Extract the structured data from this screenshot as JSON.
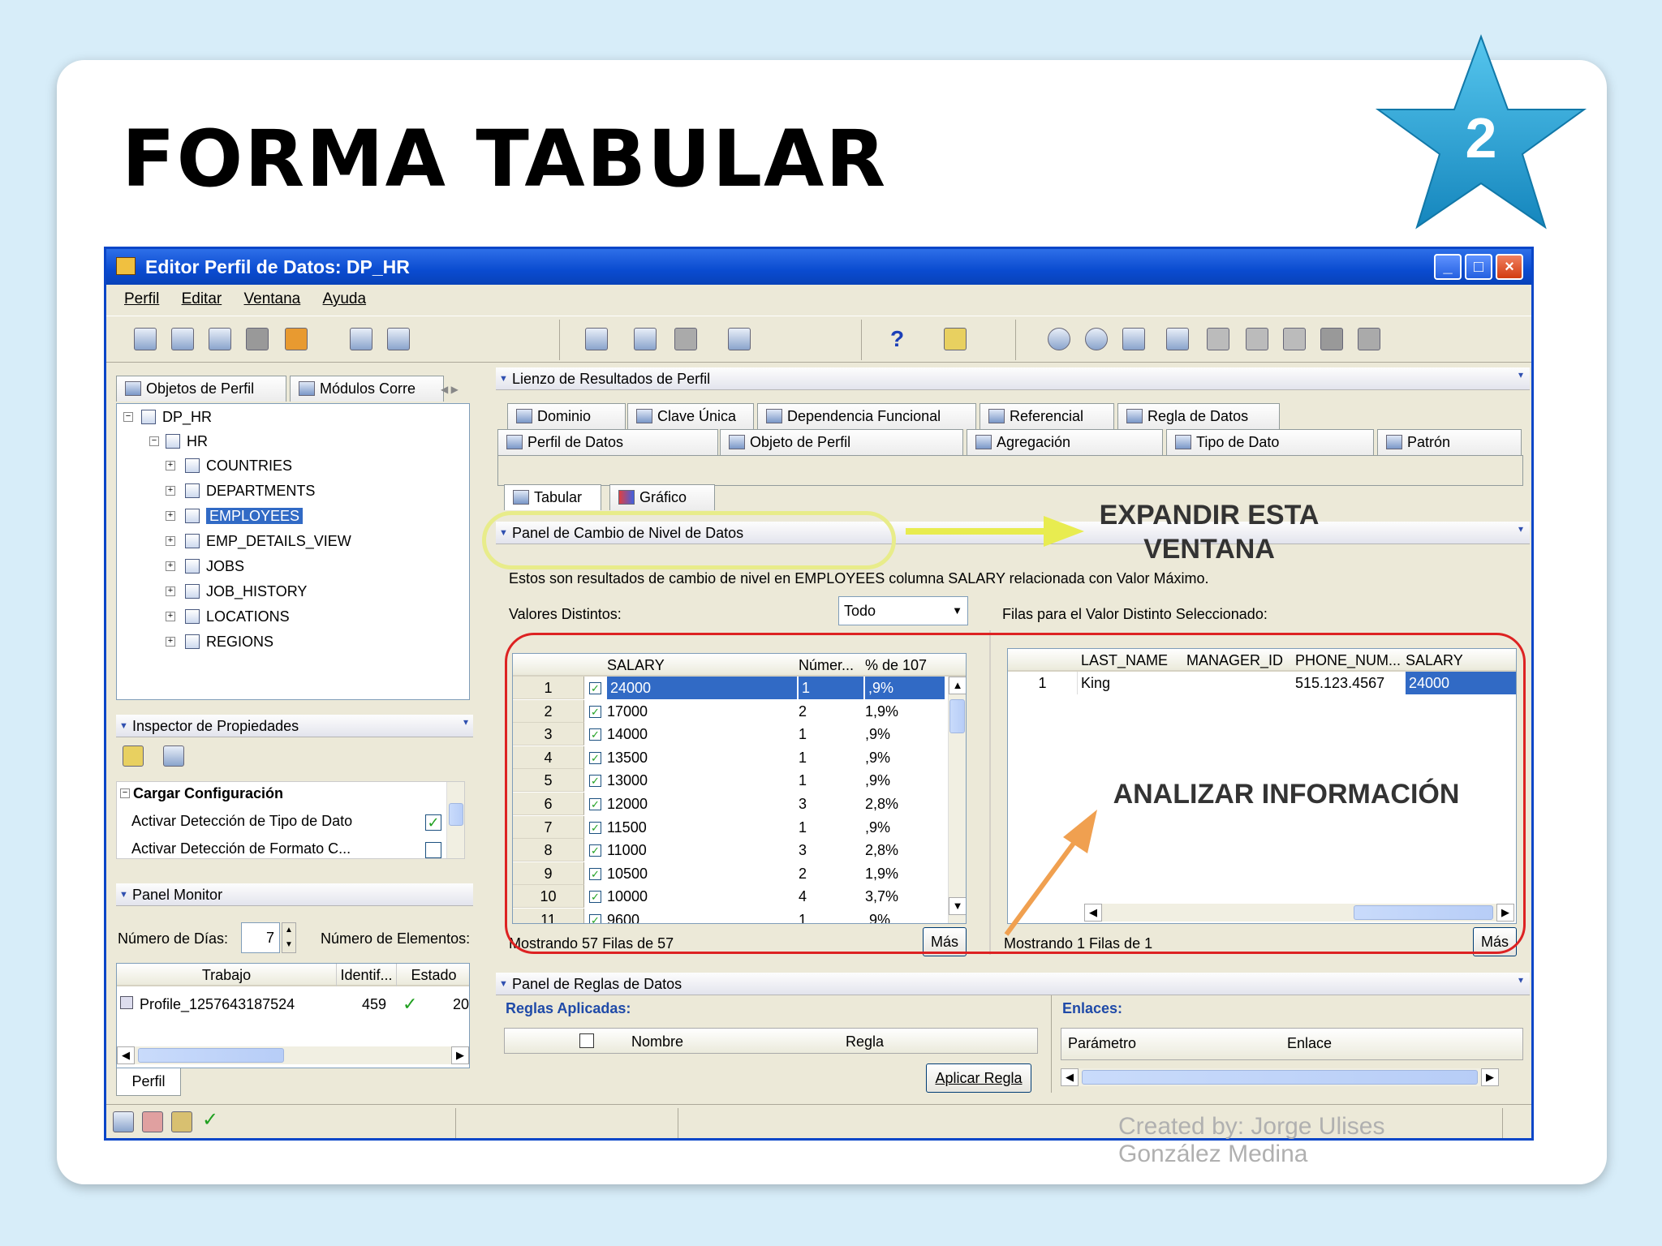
{
  "slide": {
    "title": "FORMA TABULAR",
    "badge_number": "2",
    "credit_line1": "Created by: Jorge Ulises",
    "credit_line2": "González Medina",
    "badge_color": "#2aa5d6"
  },
  "window": {
    "title": "Editor Perfil de Datos: DP_HR",
    "controls": {
      "minimize": "_",
      "maximize": "□",
      "close": "×"
    }
  },
  "menu": [
    "Perfil",
    "Editar",
    "Ventana",
    "Ayuda"
  ],
  "left_tabs": {
    "objects": "Objetos de Perfil",
    "modules": "Módulos Corre"
  },
  "tree": {
    "root": "DP_HR",
    "schema": "HR",
    "tables": [
      "COUNTRIES",
      "DEPARTMENTS",
      "EMPLOYEES",
      "EMP_DETAILS_VIEW",
      "JOBS",
      "JOB_HISTORY",
      "LOCATIONS",
      "REGIONS"
    ],
    "selected": "EMPLOYEES"
  },
  "inspector": {
    "title": "Inspector de Propiedades",
    "group": "Cargar Configuración",
    "props": [
      {
        "label": "Activar Detección de Tipo de Dato",
        "checked": true
      },
      {
        "label": "Activar Detección de Formato C...",
        "checked": false
      }
    ]
  },
  "monitor": {
    "title": "Panel Monitor",
    "days_label": "Número de Días:",
    "days_value": "7",
    "elements_label": "Número de Elementos:",
    "columns": [
      "Trabajo",
      "Identif...",
      "Estado"
    ],
    "row": {
      "job": "Profile_1257643187524",
      "id": "459",
      "status": "✓",
      "extra": "20"
    },
    "bottom_tab": "Perfil"
  },
  "canvas": {
    "title": "Lienzo de Resultados de Perfil",
    "tabs_row1": [
      "Dominio",
      "Clave Única",
      "Dependencia Funcional",
      "Referencial",
      "Regla de Datos"
    ],
    "tabs_row2": [
      "Perfil de Datos",
      "Objeto de Perfil",
      "Agregación",
      "Tipo de Dato",
      "Patrón"
    ],
    "view_tabs": [
      "Tabular",
      "Gráfico"
    ]
  },
  "drill_panel": {
    "title": "Panel de Cambio de Nivel de Datos",
    "description": "Estos son resultados de cambio de nivel en EMPLOYEES columna SALARY relacionada con Valor Máximo.",
    "distinct_label": "Valores Distintos:",
    "distinct_select": "Todo",
    "rows_label": "Filas para el Valor Distinto Seleccionado:",
    "left_columns": [
      "SALARY",
      "Númer...",
      "% de 107"
    ],
    "left_rows": [
      {
        "n": "1",
        "salary": "24000",
        "count": "1",
        "pct": ",9%"
      },
      {
        "n": "2",
        "salary": "17000",
        "count": "2",
        "pct": "1,9%"
      },
      {
        "n": "3",
        "salary": "14000",
        "count": "1",
        "pct": ",9%"
      },
      {
        "n": "4",
        "salary": "13500",
        "count": "1",
        "pct": ",9%"
      },
      {
        "n": "5",
        "salary": "13000",
        "count": "1",
        "pct": ",9%"
      },
      {
        "n": "6",
        "salary": "12000",
        "count": "3",
        "pct": "2,8%"
      },
      {
        "n": "7",
        "salary": "11500",
        "count": "1",
        "pct": ",9%"
      },
      {
        "n": "8",
        "salary": "11000",
        "count": "3",
        "pct": "2,8%"
      },
      {
        "n": "9",
        "salary": "10500",
        "count": "2",
        "pct": "1,9%"
      },
      {
        "n": "10",
        "salary": "10000",
        "count": "4",
        "pct": "3,7%"
      },
      {
        "n": "11",
        "salary": "9600",
        "count": "1",
        "pct": ",9%"
      }
    ],
    "left_footer": "Mostrando 57 Filas de 57",
    "more": "Más",
    "right_columns": [
      "LAST_NAME",
      "MANAGER_ID",
      "PHONE_NUM...",
      "SALARY"
    ],
    "right_rows": [
      {
        "n": "1",
        "last_name": "King",
        "manager_id": "",
        "phone": "515.123.4567",
        "salary": "24000"
      }
    ],
    "right_footer": "Mostrando 1 Filas de 1"
  },
  "rules_panel": {
    "title": "Panel de Reglas de Datos",
    "applied": "Reglas Aplicadas:",
    "columns": [
      "Nombre",
      "Regla"
    ],
    "apply_button": "Aplicar Regla",
    "links": "Enlaces:",
    "link_columns": [
      "Parámetro",
      "Enlace"
    ]
  },
  "annotations": {
    "expand": "EXPANDIR ESTA\nVENTANA",
    "expand_line1": "EXPANDIR ESTA",
    "expand_line2": "VENTANA",
    "analyze": "ANALIZAR INFORMACIÓN"
  },
  "colors": {
    "selection": "#316ac5",
    "highlight_box": "#dd2222",
    "oval": "#e8ec8a",
    "arrow_yellow": "#e8ec50",
    "arrow_orange": "#f0a050"
  }
}
